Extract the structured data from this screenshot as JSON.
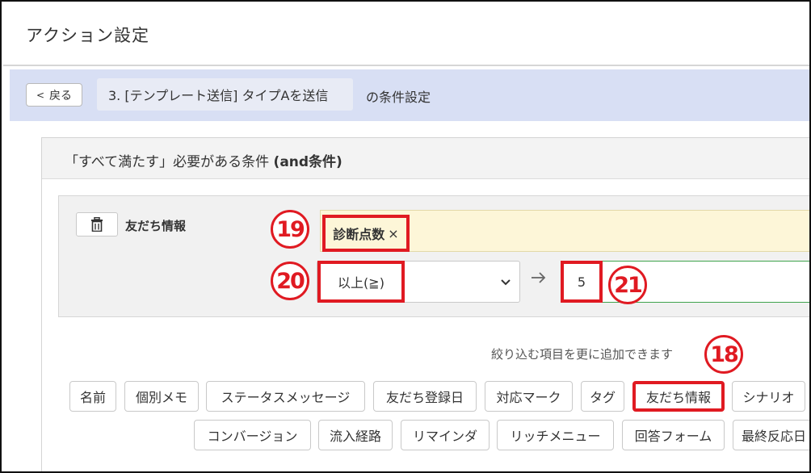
{
  "window": {
    "title": "アクション設定"
  },
  "condition_header": {
    "back_label": "戻る",
    "step_label": "3. [テンプレート送信] タイプAを送信",
    "suffix": "の条件設定"
  },
  "panel": {
    "heading_prefix": "「すべて満たす」必要がある条件 ",
    "heading_bold": "(and条件)"
  },
  "condition": {
    "category_label": "友だち情報",
    "field_tag": "診断点数",
    "field_tag_remove": "×",
    "operator": "以上(≧)",
    "value": "5"
  },
  "markers": {
    "m18": "18",
    "m19": "19",
    "m20": "20",
    "m21": "21"
  },
  "add_filters": {
    "hint": "絞り込む項目を更に追加できます",
    "row1": [
      "名前",
      "個別メモ",
      "ステータスメッセージ",
      "友だち登録日",
      "対応マーク",
      "タグ",
      "友だち情報",
      "シナリオ"
    ],
    "row2": [
      "コンバージョン",
      "流入経路",
      "リマインダ",
      "リッチメニュー",
      "回答フォーム",
      "最終反応日"
    ],
    "selected": "友だち情報"
  },
  "colors": {
    "highlight": "#e01a22",
    "header_band": "#d8dff4",
    "tag_area": "#fdf6d8",
    "value_border": "#3fa34d"
  },
  "icons": {
    "back": "chevron-left-icon",
    "trash": "trash-icon",
    "select": "chevron-down-icon",
    "arrow": "arrow-right-icon"
  }
}
